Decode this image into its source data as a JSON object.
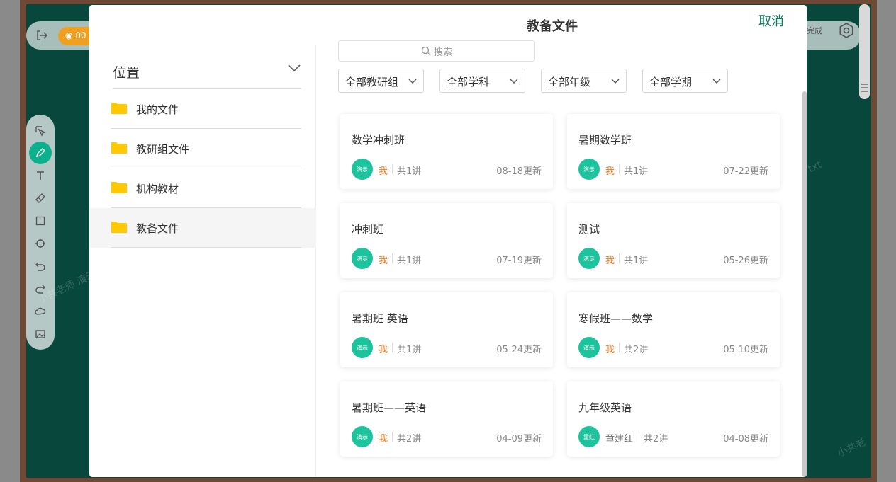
{
  "background": {
    "timer": "00",
    "done_label": "完成",
    "watermarks": [
      "小共老师 演示",
      "txt",
      "小共老"
    ]
  },
  "modal": {
    "title": "教备文件",
    "cancel_label": "取消"
  },
  "sidebar": {
    "header": "位置",
    "items": [
      {
        "label": "我的文件",
        "active": false
      },
      {
        "label": "教研组文件",
        "active": false
      },
      {
        "label": "机构教材",
        "active": false
      },
      {
        "label": "教备文件",
        "active": true
      }
    ]
  },
  "search": {
    "placeholder": "搜索"
  },
  "filters": [
    "全部教研组",
    "全部学科",
    "全部年级",
    "全部学期"
  ],
  "cards": [
    {
      "title": "数学冲刺班",
      "avatar": "演示",
      "owner": "我",
      "count": "共1讲",
      "updated": "08-18更新"
    },
    {
      "title": "暑期数学班",
      "avatar": "演示",
      "owner": "我",
      "count": "共1讲",
      "updated": "07-22更新"
    },
    {
      "title": "冲刺班",
      "avatar": "演示",
      "owner": "我",
      "count": "共1讲",
      "updated": "07-19更新"
    },
    {
      "title": "测试",
      "avatar": "演示",
      "owner": "我",
      "count": "共1讲",
      "updated": "05-26更新"
    },
    {
      "title": "暑期班 英语",
      "avatar": "演示",
      "owner": "我",
      "count": "共1讲",
      "updated": "05-24更新"
    },
    {
      "title": "寒假班——数学",
      "avatar": "演示",
      "owner": "我",
      "count": "共2讲",
      "updated": "05-10更新"
    },
    {
      "title": "暑期班——英语",
      "avatar": "演示",
      "owner": "我",
      "count": "共2讲",
      "updated": "04-09更新"
    },
    {
      "title": "九年级英语",
      "avatar": "童红",
      "owner": "童建红",
      "count": "共2讲",
      "updated": "04-08更新"
    }
  ],
  "colors": {
    "accent": "#0b7a5b",
    "avatar": "#1cc39c",
    "owner_self": "#f07a20",
    "folder": "#ffc800",
    "board": "#07473c"
  }
}
